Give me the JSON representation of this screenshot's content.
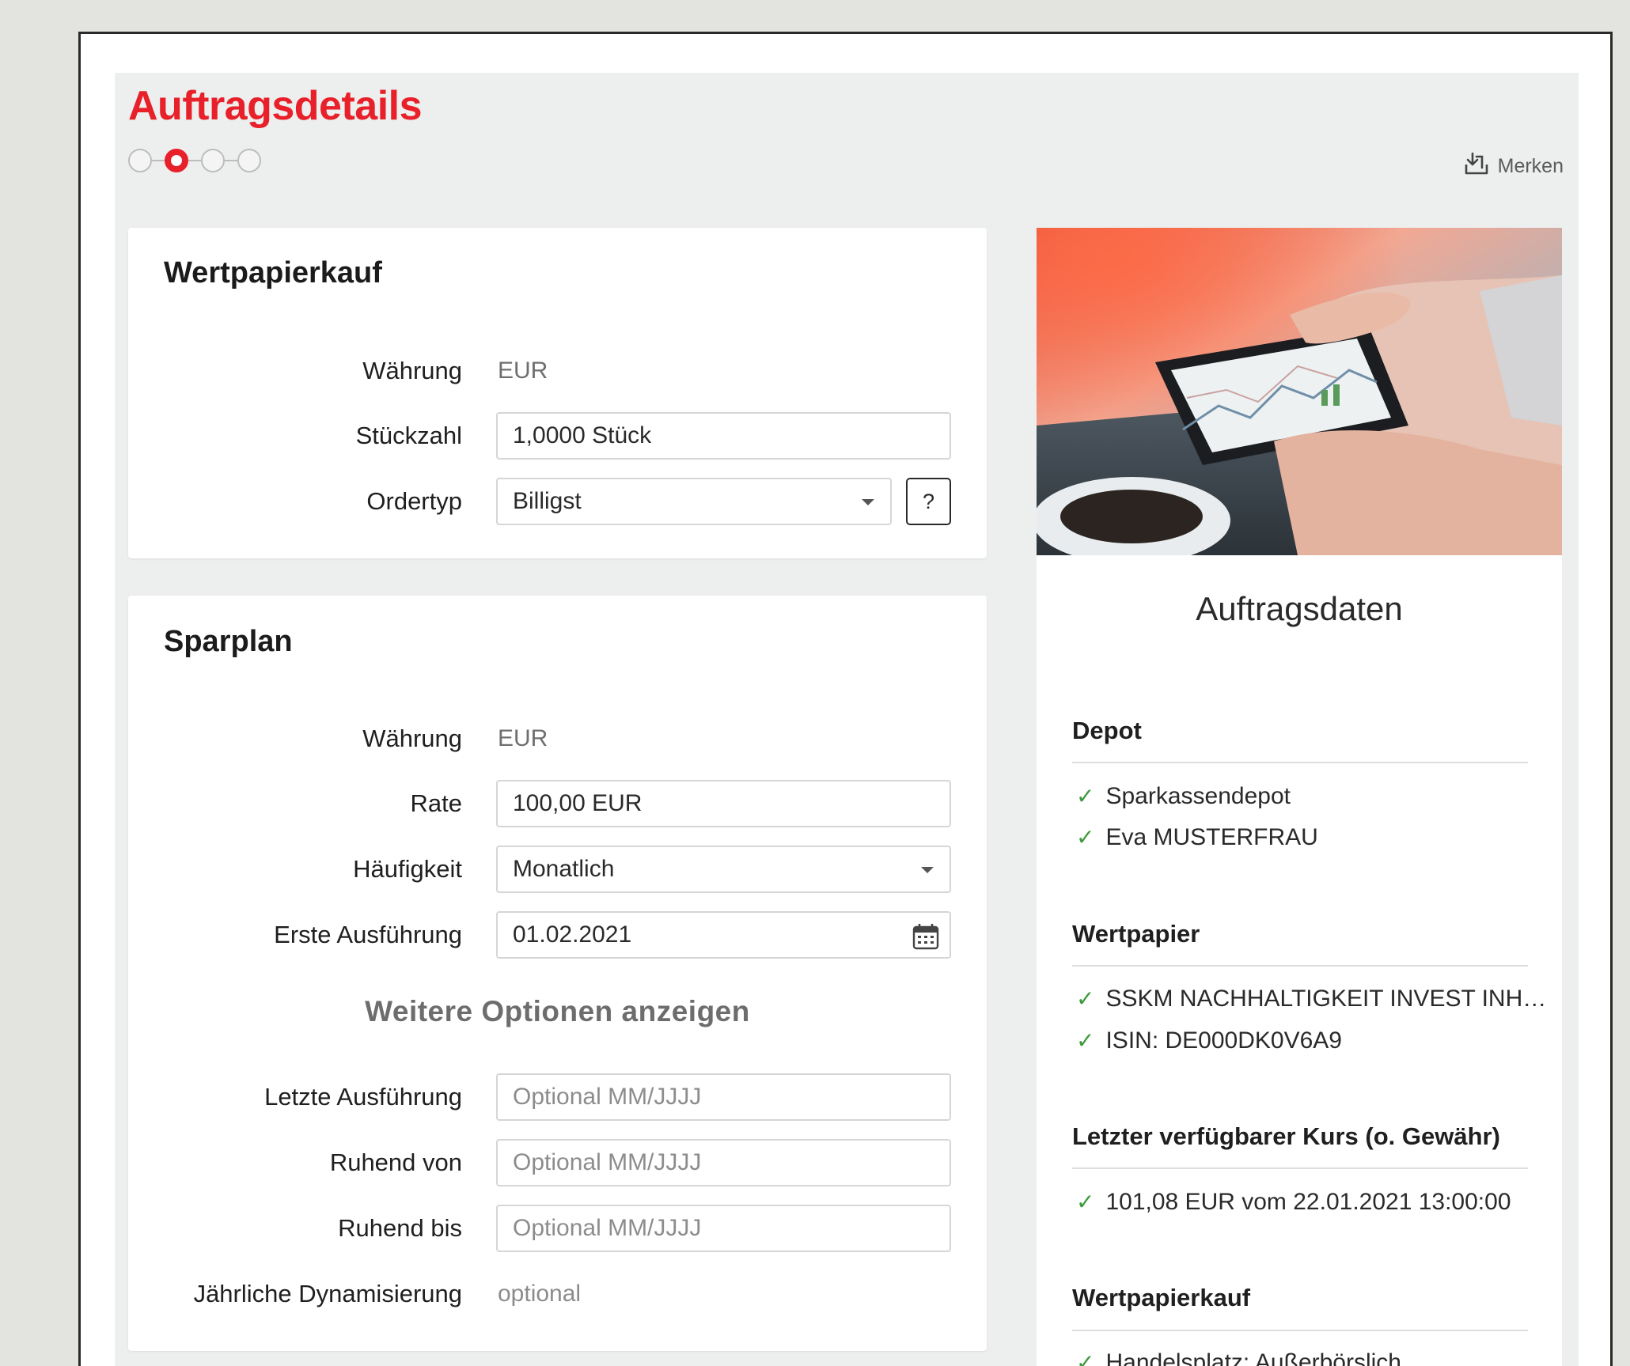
{
  "header": {
    "title": "Auftragsdetails",
    "steps": 4,
    "active_step": 2,
    "merken_label": "Merken"
  },
  "wertpapierkauf": {
    "title": "Wertpapierkauf",
    "waehrung_label": "Währung",
    "waehrung_value": "EUR",
    "stueckzahl_label": "Stückzahl",
    "stueckzahl_value": "1,0000  Stück",
    "ordertyp_label": "Ordertyp",
    "ordertyp_value": "Billigst",
    "help_label": "?"
  },
  "sparplan": {
    "title": "Sparplan",
    "waehrung_label": "Währung",
    "waehrung_value": "EUR",
    "rate_label": "Rate",
    "rate_value": "100,00  EUR",
    "haeufigkeit_label": "Häufigkeit",
    "haeufigkeit_value": "Monatlich",
    "erste_label": "Erste Ausführung",
    "erste_value": "01.02.2021",
    "more_options": "Weitere Optionen anzeigen",
    "letzte_label": "Letzte Ausführung",
    "letzte_placeholder": "Optional  MM/JJJJ",
    "ruhend_von_label": "Ruhend von",
    "ruhend_von_placeholder": "Optional  MM/JJJJ",
    "ruhend_bis_label": "Ruhend bis",
    "ruhend_bis_placeholder": "Optional  MM/JJJJ",
    "dynamisierung_label": "Jährliche Dynamisierung",
    "dynamisierung_value": "optional"
  },
  "summary": {
    "title": "Auftragsdaten",
    "sections": [
      {
        "heading": "Depot",
        "items": [
          "Sparkassendepot",
          "Eva MUSTERFRAU"
        ]
      },
      {
        "heading": "Wertpapier",
        "items": [
          "SSKM NACHHALTIGKEIT INVEST INH…",
          "ISIN: DE000DK0V6A9"
        ]
      },
      {
        "heading": "Letzter verfügbarer Kurs (o. Gewähr)",
        "items": [
          "101,08 EUR vom 22.01.2021 13:00:00"
        ]
      },
      {
        "heading": "Wertpapierkauf",
        "items": [
          "Handelsplatz: Außerbörslich"
        ]
      }
    ]
  },
  "colors": {
    "brand_red": "#e8202a",
    "check_green": "#3c9a3c",
    "panel_bg": "#edeeee"
  },
  "icons": {
    "merken": "download-tray-icon",
    "calendar": "calendar-icon",
    "dropdown": "chevron-down-icon",
    "check": "check-icon"
  }
}
